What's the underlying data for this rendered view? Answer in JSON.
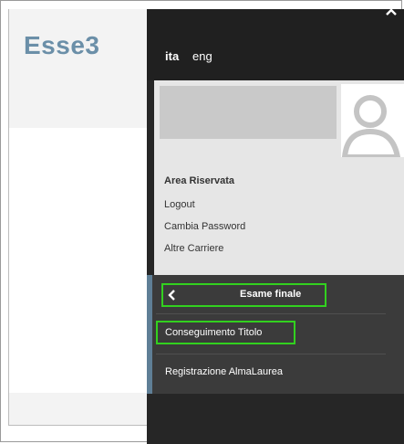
{
  "background_page": {
    "logo_text": "Esse3"
  },
  "panel": {
    "languages": [
      {
        "label": "ita",
        "active": true
      },
      {
        "label": "eng",
        "active": false
      }
    ],
    "user_area": {
      "title": "Area Riservata",
      "links": [
        "Logout",
        "Cambia Password",
        "Altre Carriere"
      ]
    },
    "nav": {
      "header_label": "Esame finale",
      "items": [
        "Conseguimento Titolo",
        "Registrazione AlmaLaurea"
      ]
    }
  },
  "colors": {
    "highlight": "#32d11f",
    "panel_dark": "#262626",
    "accent": "#5f7f96",
    "logo": "#6b8fa8"
  },
  "icons": [
    "close-icon",
    "avatar-icon",
    "chevron-left-icon"
  ]
}
